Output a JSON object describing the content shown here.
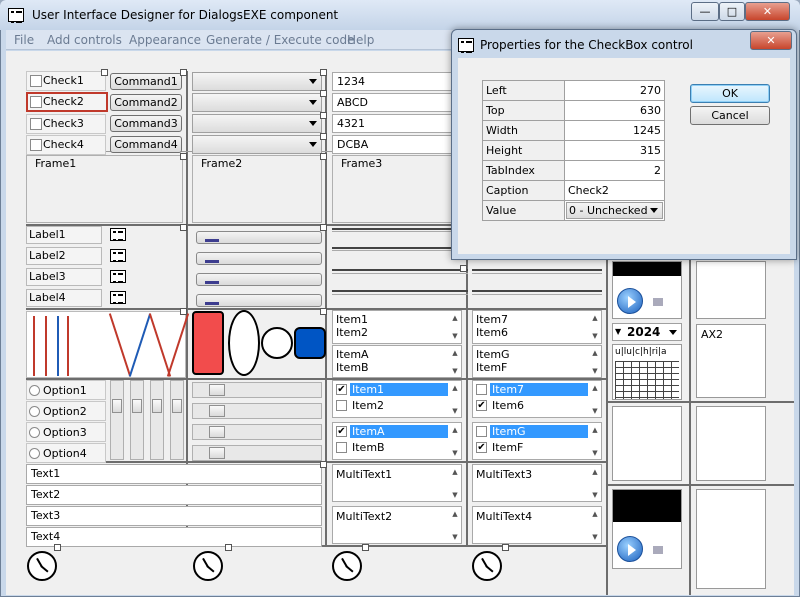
{
  "main_window": {
    "title": "User Interface Designer for DialogsEXE component",
    "minimize_glyph": "—",
    "maximize_glyph": "□",
    "close_glyph": "✕"
  },
  "menu": [
    "File",
    "Add controls",
    "Appearance",
    "Generate / Execute code",
    "Help"
  ],
  "checkboxes": [
    "Check1",
    "Check2",
    "Check3",
    "Check4"
  ],
  "commands": [
    "Command1",
    "Command2",
    "Command3",
    "Command4"
  ],
  "textboxes_top": [
    "1234",
    "ABCD",
    "4321",
    "DCBA"
  ],
  "frames": [
    "Frame1",
    "Frame2",
    "Frame3"
  ],
  "labels": [
    "Label1",
    "Label2",
    "Label3",
    "Label4"
  ],
  "options": [
    "Option1",
    "Option2",
    "Option3",
    "Option4"
  ],
  "lists_a": [
    [
      "Item1",
      "Item2"
    ],
    [
      "ItemA",
      "ItemB"
    ]
  ],
  "lists_b": [
    [
      "Item7",
      "Item6"
    ],
    [
      "ItemG",
      "ItemF"
    ]
  ],
  "checklists_a": [
    {
      "items": [
        {
          "label": "Item1",
          "checked": true,
          "selected": true
        },
        {
          "label": "Item2",
          "checked": false,
          "selected": false
        }
      ]
    },
    {
      "items": [
        {
          "label": "ItemA",
          "checked": true,
          "selected": true
        },
        {
          "label": "ItemB",
          "checked": false,
          "selected": false
        }
      ]
    }
  ],
  "checklists_b": [
    {
      "items": [
        {
          "label": "Item7",
          "checked": false,
          "selected": true
        },
        {
          "label": "Item6",
          "checked": true,
          "selected": false
        }
      ]
    },
    {
      "items": [
        {
          "label": "ItemG",
          "checked": false,
          "selected": true
        },
        {
          "label": "ItemF",
          "checked": true,
          "selected": false
        }
      ]
    }
  ],
  "texts": [
    "Text1",
    "Text2",
    "Text3",
    "Text4"
  ],
  "multitexts": [
    "MultiText1",
    "MultiText3",
    "MultiText2",
    "MultiText4"
  ],
  "year_combo": "2024",
  "calendar_header": [
    "u",
    "lu",
    "c",
    "h",
    "ri",
    "a"
  ],
  "ax_label": "AX2",
  "properties_dialog": {
    "title": "Properties for the CheckBox control",
    "close_glyph": "✕",
    "rows": [
      {
        "key": "Left",
        "value": "270"
      },
      {
        "key": "Top",
        "value": "630"
      },
      {
        "key": "Width",
        "value": "1245"
      },
      {
        "key": "Height",
        "value": "315"
      },
      {
        "key": "TabIndex",
        "value": "2"
      },
      {
        "key": "Caption",
        "value": "Check2"
      },
      {
        "key": "Value",
        "value": "0 - Unchecked"
      }
    ],
    "ok_label": "OK",
    "cancel_label": "Cancel"
  },
  "colors": {
    "title_bg": "#c9d8ea",
    "selection": "#3399ff",
    "red_shape": "#f24c4c",
    "blue_shape": "#0055c4",
    "selected_control_border": "#c0392b"
  }
}
